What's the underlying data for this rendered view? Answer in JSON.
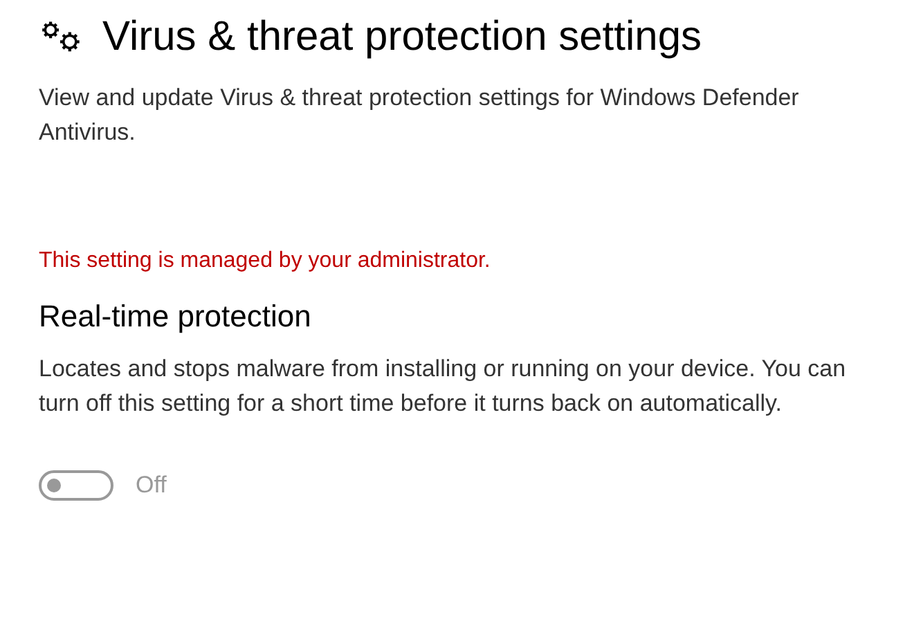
{
  "page": {
    "title": "Virus & threat protection settings",
    "description": "View and update Virus & threat protection settings for Windows Defender Antivirus."
  },
  "notice": "This setting is managed by your administrator.",
  "section": {
    "heading": "Real-time protection",
    "description": "Locates and stops malware from installing or running on your device. You can turn off this setting for a short time before it turns back on automatically.",
    "toggle": {
      "on": false,
      "disabled": true,
      "label": "Off"
    }
  }
}
